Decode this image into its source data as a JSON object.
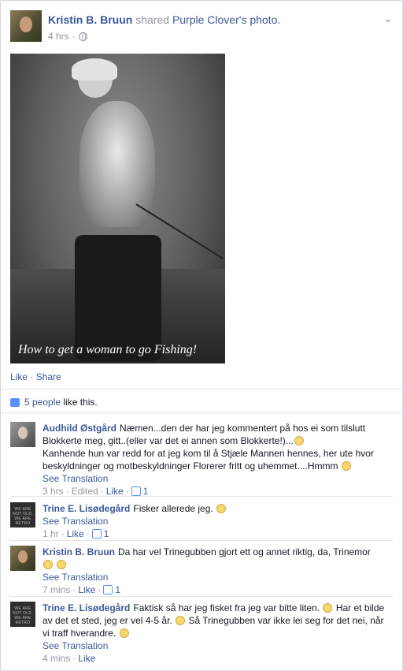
{
  "post": {
    "author": "Kristin B. Bruun",
    "verb": "shared",
    "source": "Purple Clover",
    "object": "'s photo.",
    "time": "4 hrs",
    "photo_caption": "How to get a woman to go Fishing!",
    "like_label": "Like",
    "share_label": "Share",
    "sep": " · ",
    "likes_count": "5 people",
    "likes_suffix": " like this."
  },
  "comments": [
    {
      "author": "Audhild Østgård",
      "text1": "Næmen...den der har jeg kommentert på hos ei som tilslutt Blokkerte meg, gitt..(eller var det ei annen som Blokkerte!)...",
      "text2": "Kanhende hun var redd for at jeg kom til å Stjæle Mannen hennes, her ute hvor beskyldninger og motbeskyldninger Florerer fritt og uhemmet....Hmmm",
      "see_translation": "See Translation",
      "time": "3 hrs",
      "edited": "Edited",
      "like_label": "Like",
      "like_count": "1"
    },
    {
      "author": "Trine E. Lisødegård",
      "text1": "Fisker allerede jeg.",
      "see_translation": "See Translation",
      "time": "1 hr",
      "like_label": "Like",
      "like_count": "1"
    },
    {
      "author": "Kristin B. Bruun",
      "text1": "Da har vel Trinegubben gjort ett og annet riktig, da, Trinemor",
      "see_translation": "See Translation",
      "time": "7 mins",
      "like_label": "Like",
      "like_count": "1"
    },
    {
      "author": "Trine E. Lisødegård",
      "text1": "Faktisk så har jeg fisket fra jeg var bitte liten.",
      "text2": "Har et bilde av det et sted, jeg er vel 4-5 år.",
      "text3": "Så Trinegubben var ikke lei seg for det nei, når vi traff hverandre.",
      "see_translation": "See Translation",
      "time": "4 mins",
      "like_label": "Like"
    }
  ],
  "retro_avatar_text": "WE ARE NOT OLD, WE ARE RETRO"
}
